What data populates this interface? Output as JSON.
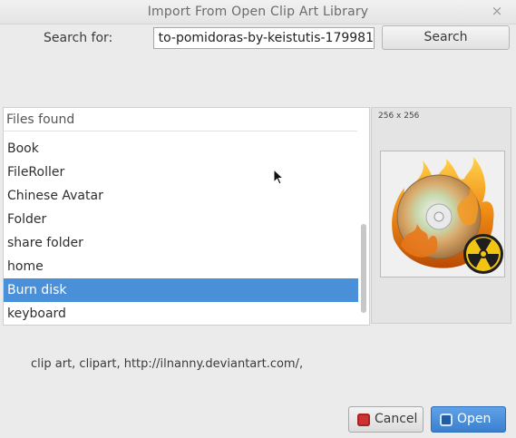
{
  "window": {
    "title": "Import From Open Clip Art Library",
    "close_glyph": "×"
  },
  "search": {
    "label": "Search for:",
    "value": "to-pomidoras-by-keistutis-179981",
    "button_label": "Search"
  },
  "files": {
    "header": "Files found",
    "items": [
      {
        "label": "Book",
        "selected": false
      },
      {
        "label": "FileRoller",
        "selected": false
      },
      {
        "label": "Chinese Avatar",
        "selected": false
      },
      {
        "label": "Folder",
        "selected": false
      },
      {
        "label": "share folder",
        "selected": false
      },
      {
        "label": "home",
        "selected": false
      },
      {
        "label": "Burn disk",
        "selected": true
      },
      {
        "label": "keyboard",
        "selected": false
      }
    ]
  },
  "preview": {
    "size_label": "256 x 256",
    "image_icon": "burn-disc-icon"
  },
  "description": "clip art, clipart, http://ilnanny.deviantart.com/,",
  "buttons": {
    "cancel_label": "Cancel",
    "open_label": "Open"
  },
  "colors": {
    "selection": "#4a90d9",
    "open_button": "#3b80cf"
  }
}
